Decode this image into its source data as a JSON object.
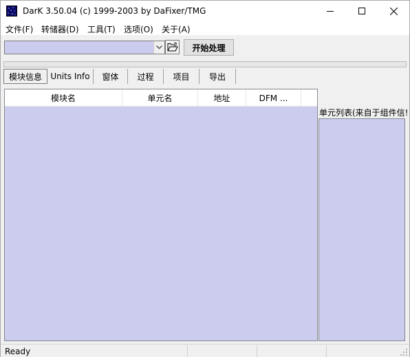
{
  "window": {
    "title": "DarK 3.50.04 (c) 1999-2003 by DaFixer/TMG",
    "app_icon": "app-icon",
    "minimize_icon": "minimize-icon",
    "maximize_icon": "maximize-icon",
    "close_icon": "close-icon"
  },
  "menu": {
    "items": [
      {
        "label": "文件(F)"
      },
      {
        "label": "转储器(D)"
      },
      {
        "label": "工具(T)"
      },
      {
        "label": "选项(O)"
      },
      {
        "label": "关于(A)"
      }
    ]
  },
  "toolbar": {
    "file_combo_value": "",
    "dropdown_icon": "chevron-down-icon",
    "browse_icon": "open-folder-icon",
    "start_label": "开始处理"
  },
  "progress": {
    "value": 0
  },
  "tabs": [
    {
      "label": "模块信息",
      "active": true
    },
    {
      "label": "Units Info",
      "active": false
    },
    {
      "label": "窗体",
      "active": false
    },
    {
      "label": "过程",
      "active": false
    },
    {
      "label": "项目",
      "active": false
    },
    {
      "label": "导出",
      "active": false
    }
  ],
  "module_list": {
    "columns": [
      "模块名",
      "单元名",
      "地址",
      "DFM ..."
    ],
    "rows": []
  },
  "units_panel": {
    "label": "单元列表(来自于组件信!",
    "items": []
  },
  "status": {
    "text": "Ready"
  },
  "colors": {
    "list_background": "#cccdee",
    "window_background": "#f0f0f0"
  }
}
